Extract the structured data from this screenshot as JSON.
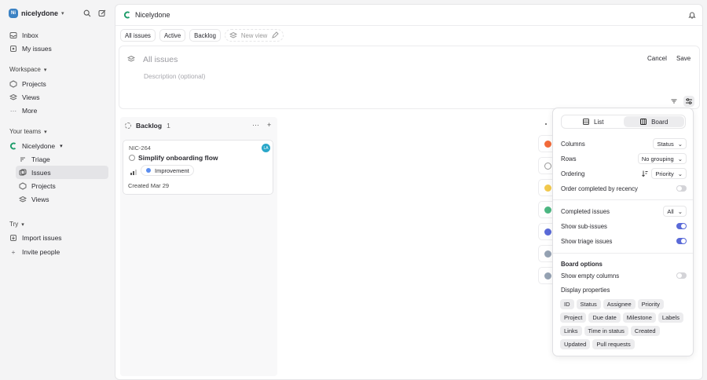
{
  "workspace": {
    "name": "nicelydone",
    "avatar": "Ni"
  },
  "sidebar": {
    "top": [
      {
        "label": "Inbox"
      },
      {
        "label": "My issues"
      }
    ],
    "workspace_heading": "Workspace",
    "workspace_items": [
      {
        "label": "Projects"
      },
      {
        "label": "Views"
      },
      {
        "label": "More"
      }
    ],
    "teams_heading": "Your teams",
    "team": {
      "name": "Nicelydone"
    },
    "team_items": [
      {
        "label": "Triage"
      },
      {
        "label": "Issues"
      },
      {
        "label": "Projects"
      },
      {
        "label": "Views"
      }
    ],
    "try_heading": "Try",
    "try_items": [
      {
        "label": "Import issues"
      },
      {
        "label": "Invite people"
      }
    ]
  },
  "header": {
    "title": "Nicelydone"
  },
  "tabs": [
    {
      "label": "All issues"
    },
    {
      "label": "Active"
    },
    {
      "label": "Backlog"
    },
    {
      "label": "New view"
    }
  ],
  "editor": {
    "name_placeholder": "All issues",
    "description_placeholder": "Description (optional)",
    "cancel": "Cancel",
    "save": "Save"
  },
  "board": {
    "column": {
      "name": "Backlog",
      "count": "1"
    },
    "card": {
      "id": "NIC-264",
      "title": "Simplify onboarding flow",
      "label": "Improvement",
      "assignee": "LA",
      "created": "Created Mar 29"
    }
  },
  "display_panel": {
    "layout_options": [
      {
        "label": "List"
      },
      {
        "label": "Board"
      }
    ],
    "selected_layout": "Board",
    "columns": {
      "label": "Columns",
      "value": "Status"
    },
    "rows": {
      "label": "Rows",
      "value": "No grouping"
    },
    "ordering": {
      "label": "Ordering",
      "value": "Priority"
    },
    "order_completed": {
      "label": "Order completed by recency",
      "on": false
    },
    "completed_issues": {
      "label": "Completed issues",
      "value": "All"
    },
    "show_sub_issues": {
      "label": "Show sub-issues",
      "on": true
    },
    "show_triage": {
      "label": "Show triage issues",
      "on": true
    },
    "board_options_heading": "Board options",
    "show_empty": {
      "label": "Show empty columns",
      "on": false
    },
    "display_properties_heading": "Display properties",
    "properties": [
      "ID",
      "Status",
      "Assignee",
      "Priority",
      "Project",
      "Due date",
      "Milestone",
      "Labels",
      "Links",
      "Time in status",
      "Created",
      "Updated",
      "Pull requests"
    ]
  },
  "colors": {
    "accent": "#5a6ad8",
    "team_logo": "#1f9d6b",
    "label_dot": "#5b8def"
  }
}
